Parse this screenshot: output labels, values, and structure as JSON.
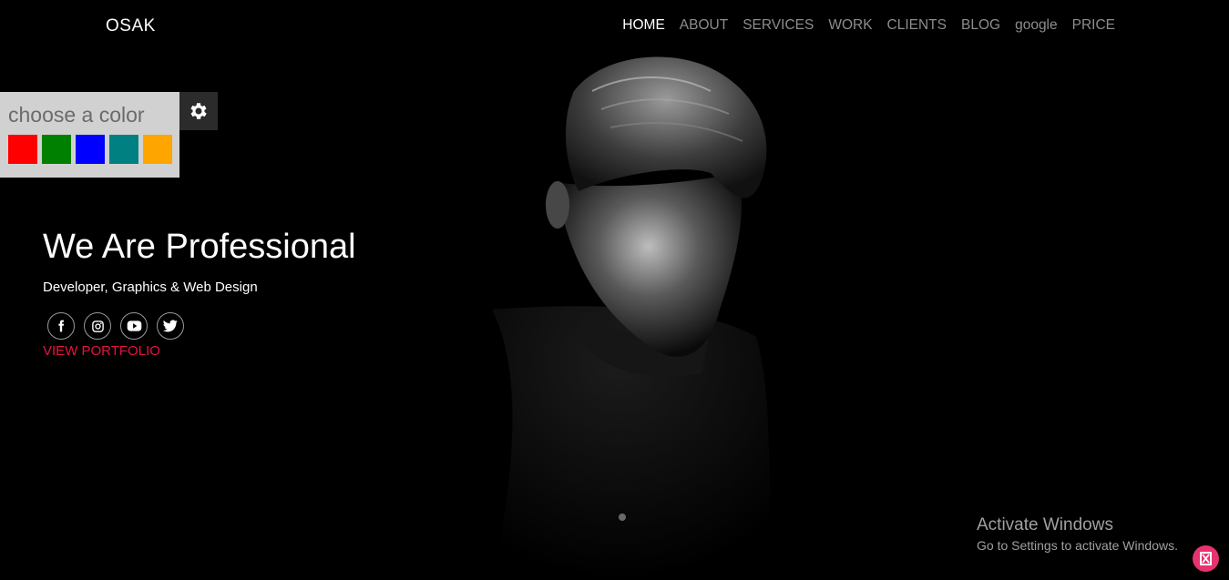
{
  "brand": {
    "name": "OSAK"
  },
  "nav": {
    "items": [
      {
        "label": "HOME",
        "active": true
      },
      {
        "label": "ABOUT"
      },
      {
        "label": "SERVICES"
      },
      {
        "label": "WORK"
      },
      {
        "label": "CLIENTS"
      },
      {
        "label": "BLOG"
      },
      {
        "label": "google"
      },
      {
        "label": "PRICE"
      }
    ]
  },
  "color_picker": {
    "title": "choose a color",
    "swatches": [
      "#ff0000",
      "#008000",
      "#0000ff",
      "#008080",
      "#ffa500"
    ],
    "settings_icon": "gear-icon"
  },
  "hero": {
    "headline": "We Are Professional",
    "subline": "Developer, Graphics & Web Design",
    "socials": [
      "facebook-icon",
      "instagram-icon",
      "youtube-icon",
      "twitter-icon"
    ],
    "cta": "VIEW PORTFOLIO"
  },
  "os_watermark": {
    "title": "Activate Windows",
    "subtitle": "Go to Settings to activate Windows."
  },
  "colors": {
    "accent": "#e8123f",
    "background": "#000000"
  }
}
